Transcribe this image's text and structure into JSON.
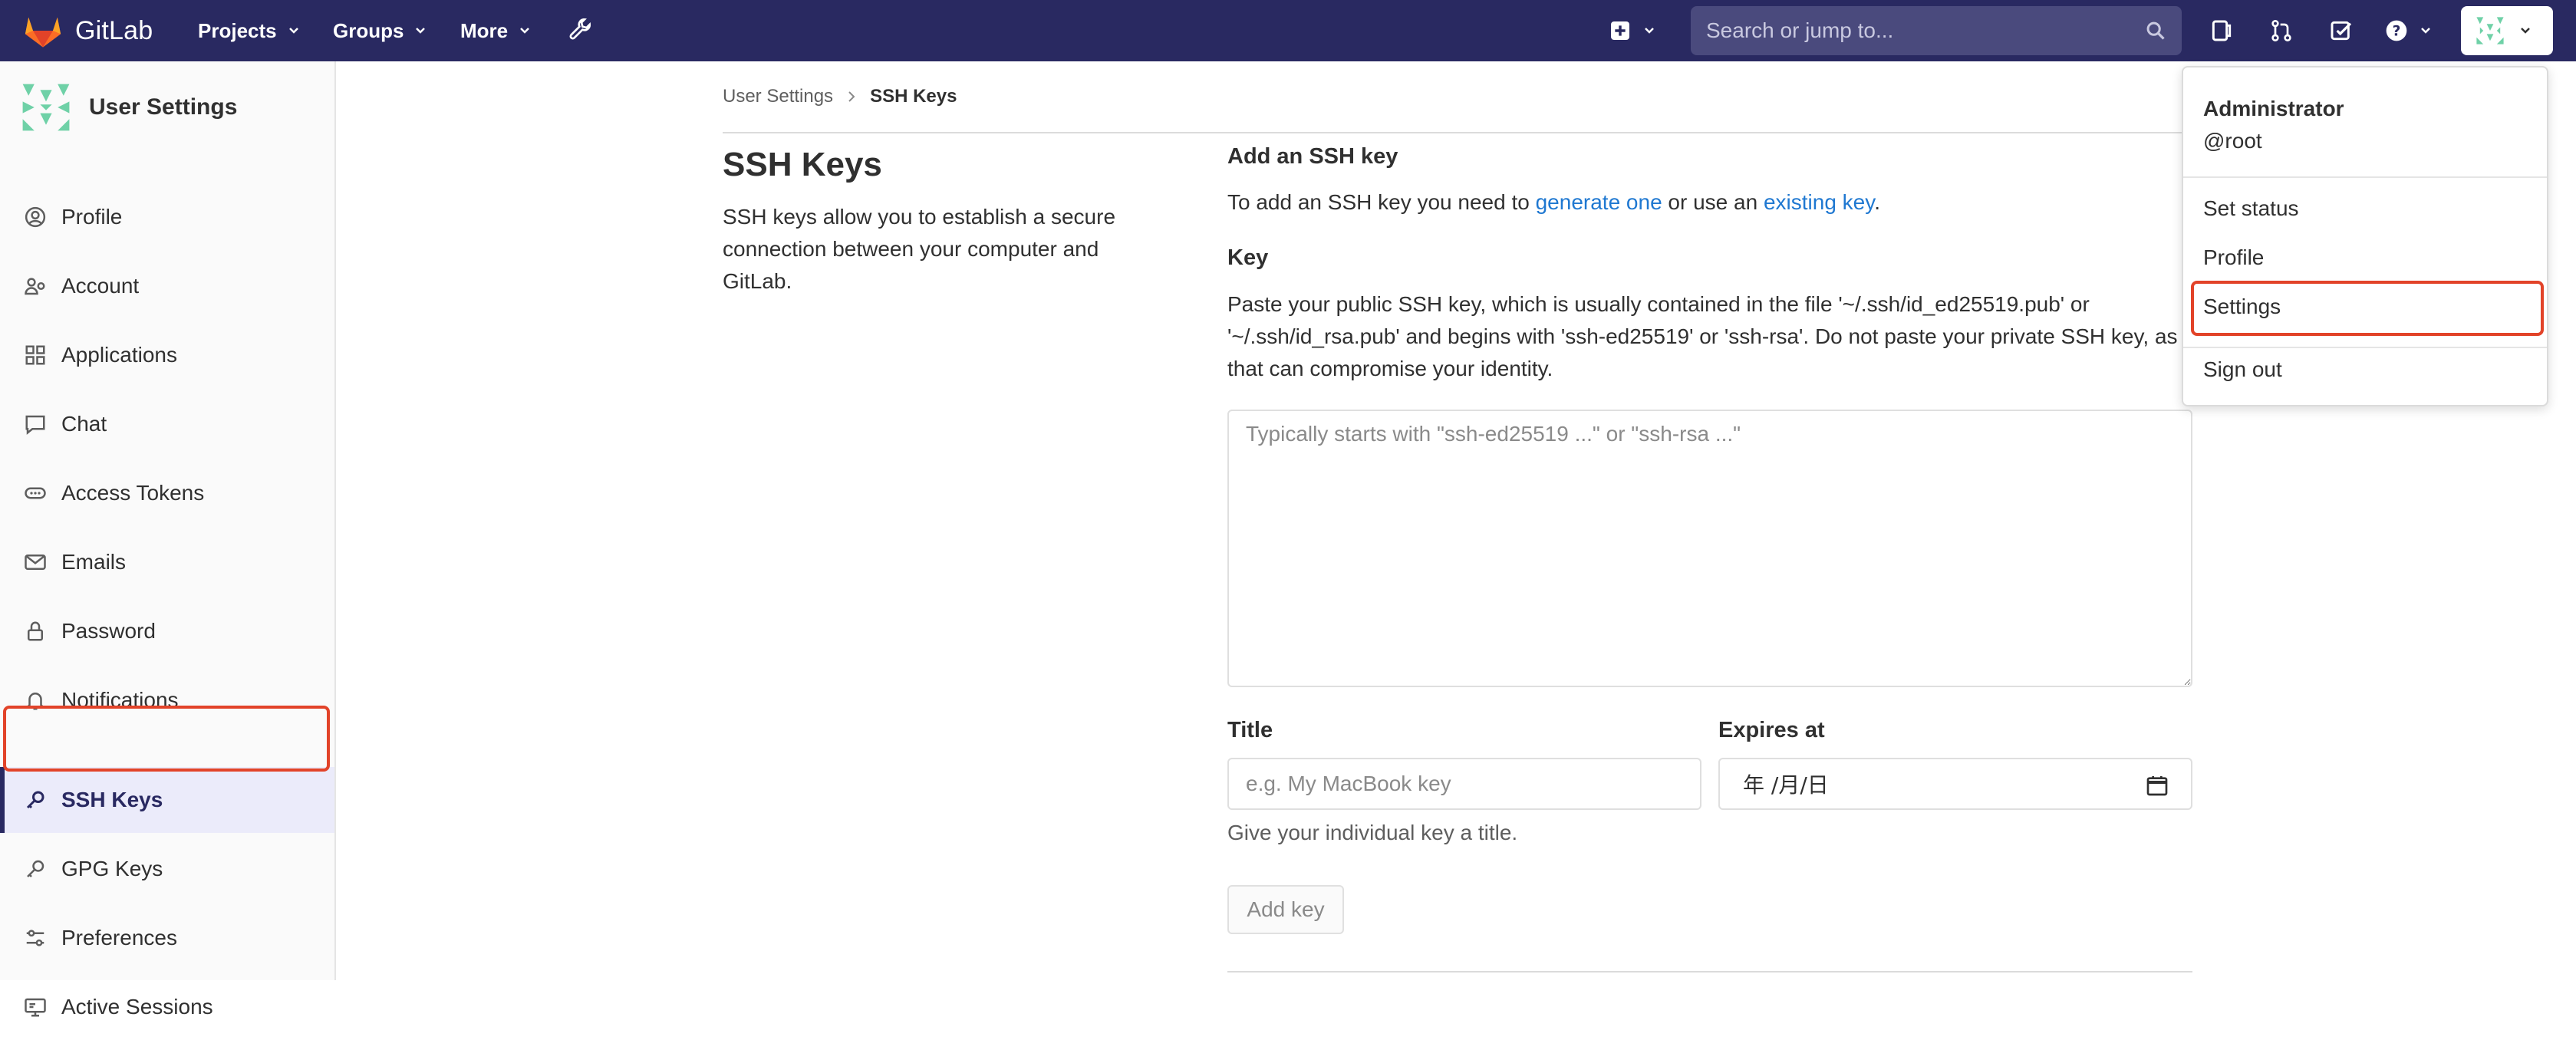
{
  "app": {
    "brand": "GitLab"
  },
  "navbar": {
    "projects": "Projects",
    "groups": "Groups",
    "more": "More",
    "search_placeholder": "Search or jump to..."
  },
  "sidebar": {
    "title": "User Settings",
    "items": [
      {
        "label": "Profile",
        "icon": "profile-icon"
      },
      {
        "label": "Account",
        "icon": "account-icon"
      },
      {
        "label": "Applications",
        "icon": "applications-icon"
      },
      {
        "label": "Chat",
        "icon": "chat-icon"
      },
      {
        "label": "Access Tokens",
        "icon": "token-icon"
      },
      {
        "label": "Emails",
        "icon": "mail-icon"
      },
      {
        "label": "Password",
        "icon": "lock-icon"
      },
      {
        "label": "Notifications",
        "icon": "bell-icon"
      },
      {
        "label": "SSH Keys",
        "icon": "key-icon",
        "active": true
      },
      {
        "label": "GPG Keys",
        "icon": "key-icon"
      },
      {
        "label": "Preferences",
        "icon": "preferences-icon"
      },
      {
        "label": "Active Sessions",
        "icon": "monitor-icon"
      }
    ]
  },
  "breadcrumb": {
    "root": "User Settings",
    "current": "SSH Keys"
  },
  "page": {
    "title": "SSH Keys",
    "description": "SSH keys allow you to establish a secure connection between your computer and GitLab."
  },
  "form": {
    "section_title": "Add an SSH key",
    "intro_prefix": "To add an SSH key you need to ",
    "intro_link1": "generate one",
    "intro_middle": " or use an ",
    "intro_link2": "existing key",
    "intro_suffix": ".",
    "key_label": "Key",
    "key_help": "Paste your public SSH key, which is usually contained in the file '~/.ssh/id_ed25519.pub' or '~/.ssh/id_rsa.pub' and begins with 'ssh-ed25519' or 'ssh-rsa'. Do not paste your private SSH key, as that can compromise your identity.",
    "key_placeholder": "Typically starts with \"ssh-ed25519 ...\" or \"ssh-rsa ...\"",
    "title_label": "Title",
    "title_placeholder": "e.g. My MacBook key",
    "title_help": "Give your individual key a title.",
    "expires_label": "Expires at",
    "expires_value": "年 /月/日",
    "submit_label": "Add key"
  },
  "user_menu": {
    "name": "Administrator",
    "handle": "@root",
    "set_status": "Set status",
    "profile": "Profile",
    "settings": "Settings",
    "sign_out": "Sign out"
  },
  "colors": {
    "navbar": "#292961",
    "link": "#1f78d1",
    "highlight": "#e24329",
    "sidebar_active": "#ebebfa"
  }
}
